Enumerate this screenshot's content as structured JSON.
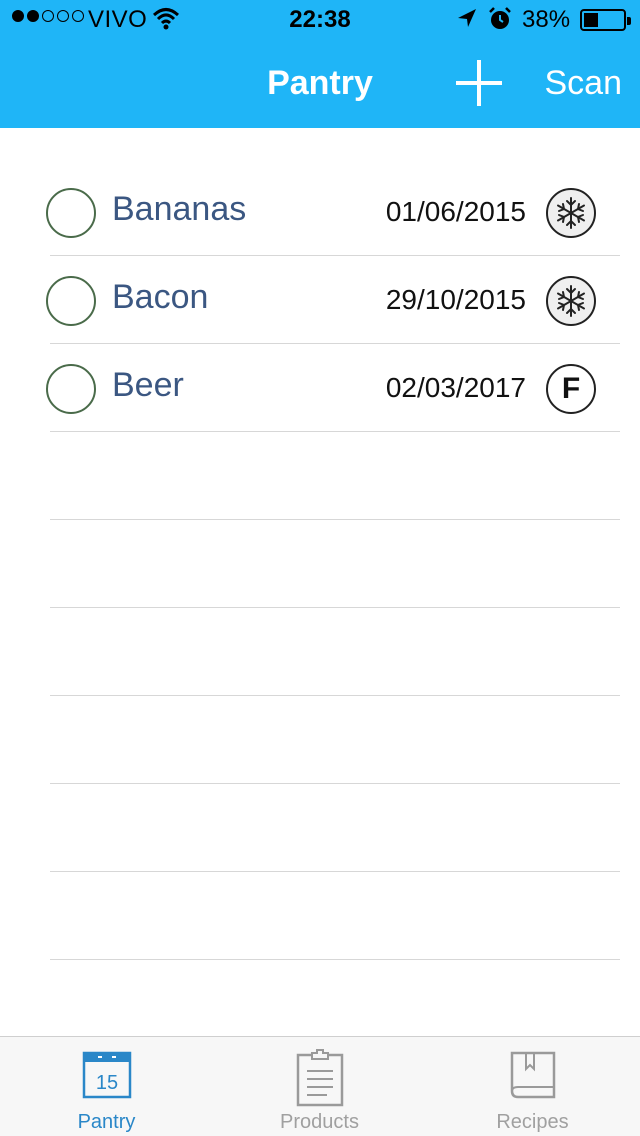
{
  "status_bar": {
    "carrier": "VIVO",
    "time": "22:38",
    "battery": "38%",
    "battery_level": 0.38
  },
  "nav": {
    "title": "Pantry",
    "add_icon": "plus-icon",
    "scan_label": "Scan",
    "bar_color": "#1fb5f7"
  },
  "items": [
    {
      "name": "Bananas",
      "date": "01/06/2015",
      "storage_icon": "snowflake-icon"
    },
    {
      "name": "Bacon",
      "date": "29/10/2015",
      "storage_icon": "snowflake-icon"
    },
    {
      "name": "Beer",
      "date": "02/03/2017",
      "storage_icon": "F",
      "storage_label": "F"
    }
  ],
  "tabs": [
    {
      "label": "Pantry",
      "icon": "calendar-icon",
      "icon_text": "15",
      "active": true
    },
    {
      "label": "Products",
      "icon": "clipboard-icon",
      "active": false
    },
    {
      "label": "Recipes",
      "icon": "book-icon",
      "active": false
    }
  ]
}
